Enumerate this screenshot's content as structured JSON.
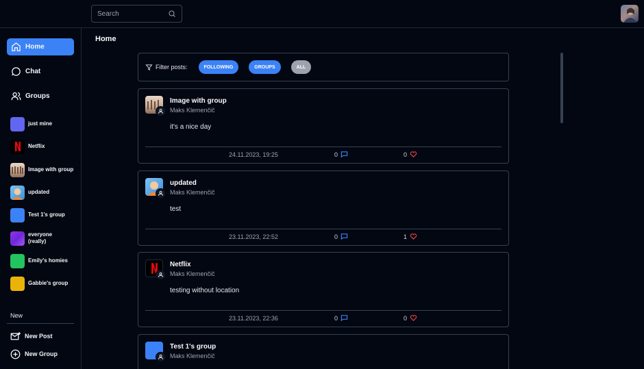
{
  "search": {
    "placeholder": "Search"
  },
  "sidebar": {
    "nav": [
      {
        "label": "Home",
        "icon": "home-icon",
        "active": true
      },
      {
        "label": "Chat",
        "icon": "chat-icon"
      },
      {
        "label": "Groups",
        "icon": "users-icon"
      }
    ],
    "groups": [
      {
        "label": "just mine",
        "color": "#6366f1"
      },
      {
        "label": "Netflix",
        "color": "#000000"
      },
      {
        "label": "Image with group",
        "color": "#c9b8a8"
      },
      {
        "label": "updated",
        "color": "#5aa9e6"
      },
      {
        "label": "Test 1's group",
        "color": "#3b82f6"
      },
      {
        "label": "everyone (really)",
        "color": "#7c3aed"
      },
      {
        "label": "Emily's homies",
        "color": "#22c55e"
      },
      {
        "label": "Gabbie's group",
        "color": "#eab308"
      }
    ],
    "new_label": "New",
    "actions": [
      {
        "label": "New Post",
        "icon": "mail-plus-icon"
      },
      {
        "label": "New Group",
        "icon": "plus-circle-icon"
      }
    ]
  },
  "page": {
    "title": "Home"
  },
  "filter": {
    "label": "Filter posts:",
    "chips": [
      "FOLLOWING",
      "GROUPS",
      "ALL"
    ]
  },
  "posts": [
    {
      "title": "Image with group",
      "author": "Maks Klemenčič",
      "content": "it's a nice day",
      "date": "24.11.2023, 19:25",
      "comments": "0",
      "likes": "0"
    },
    {
      "title": "updated",
      "author": "Maks Klemenčič",
      "content": "test",
      "date": "23.11.2023, 22:52",
      "comments": "0",
      "likes": "1"
    },
    {
      "title": "Netflix",
      "author": "Maks Klemenčič",
      "content": "testing without location",
      "date": "23.11.2023, 22:36",
      "comments": "0",
      "likes": "0"
    },
    {
      "title": "Test 1's group",
      "author": "Maks Klemenčič"
    }
  ],
  "colors": {
    "accent": "#3b82f6",
    "background": "#030712",
    "border": "#374151",
    "heart": "#ef4444"
  }
}
